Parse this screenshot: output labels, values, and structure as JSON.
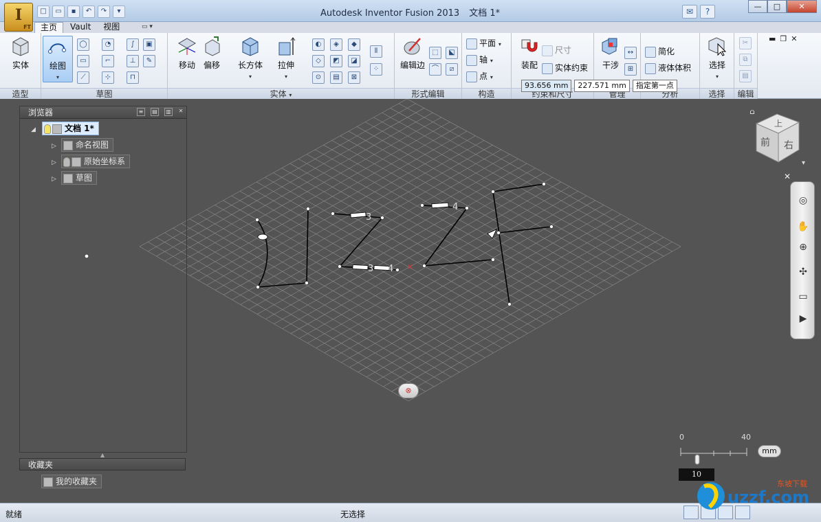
{
  "window": {
    "title": "Autodesk Inventor Fusion 2013",
    "document": "文档 1*"
  },
  "app_button": {
    "letter": "I",
    "badge": "FT"
  },
  "tabs": [
    {
      "label": "主页"
    },
    {
      "label": "Vault"
    },
    {
      "label": "视图"
    }
  ],
  "ribbon": {
    "panels": {
      "model": "造型",
      "sketch": "草图",
      "solid": "实体",
      "form_edit": "形式编辑",
      "construct": "构造",
      "constraint": "约束和尺寸",
      "analysis": "分析",
      "select": "选择",
      "edit": "编辑",
      "manage": "管理"
    },
    "buttons": {
      "solid_btn": "实体",
      "draw": "绘图",
      "move": "移动",
      "offset": "偏移",
      "box": "长方体",
      "extrude": "拉伸",
      "edit_edge": "编辑边",
      "plane": "平面",
      "axis": "轴",
      "point": "点",
      "assemble": "装配",
      "dimension": "尺寸",
      "solid_constraint": "实体约束",
      "interference": "干涉",
      "simplify": "简化",
      "fluid_volume": "液体体积",
      "select_btn": "选择"
    }
  },
  "tooltips": {
    "len1": "93.656 mm",
    "len2": "227.571 mm",
    "prompt": "指定第一点"
  },
  "browser": {
    "title": "浏览器",
    "root": "文档 1*",
    "nodes": [
      {
        "label": "命名视图"
      },
      {
        "label": "原始坐标系"
      },
      {
        "label": "草图"
      }
    ]
  },
  "favorites": {
    "title": "收藏夹",
    "item": "我的收藏夹"
  },
  "viewcube": {
    "top": "上",
    "front": "前",
    "right": "右"
  },
  "scale": {
    "min": "0",
    "max": "40",
    "unit": "mm",
    "value": "10"
  },
  "sketch_labels": {
    "c1": "3",
    "c2": "3",
    "c3": "4",
    "c4": "4"
  },
  "statusbar": {
    "left": "就绪",
    "center": "无选择"
  },
  "watermark": {
    "text": "uzzf.com",
    "cn": "东坡下载"
  },
  "colors": {
    "viewport": "#545454",
    "grid": "#8a8a8a",
    "sketch": "#000000",
    "accent": "#6a9bd1"
  }
}
